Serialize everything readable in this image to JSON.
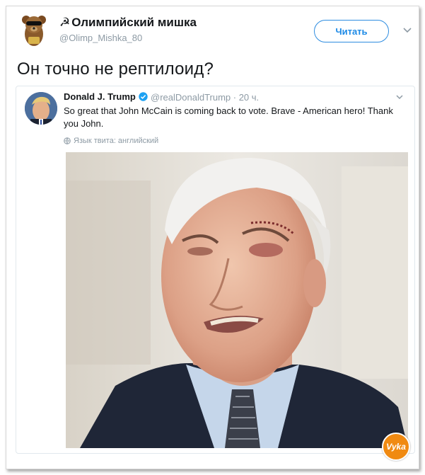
{
  "tweet": {
    "author_name": "Олимпийский мишка",
    "author_flag": "☭",
    "author_handle": "@Olimp_Mishka_80",
    "follow_label": "Читать",
    "text": "Он точно не рептилоид?",
    "avatar_icon": "bear-avatar-icon",
    "more_icon": "chevron-down-icon"
  },
  "quoted_tweet": {
    "name": "Donald J. Trump",
    "handle_time": "@realDonaldTrump · 20 ч.",
    "text": "So great that John McCain is coming back to vote. Brave - American hero! Thank you John.",
    "language_note": "Язык твита: английский",
    "verified_icon": "verified-badge-icon",
    "accent_color": "#1da1f2"
  },
  "watermark": {
    "text": "Vyka"
  }
}
